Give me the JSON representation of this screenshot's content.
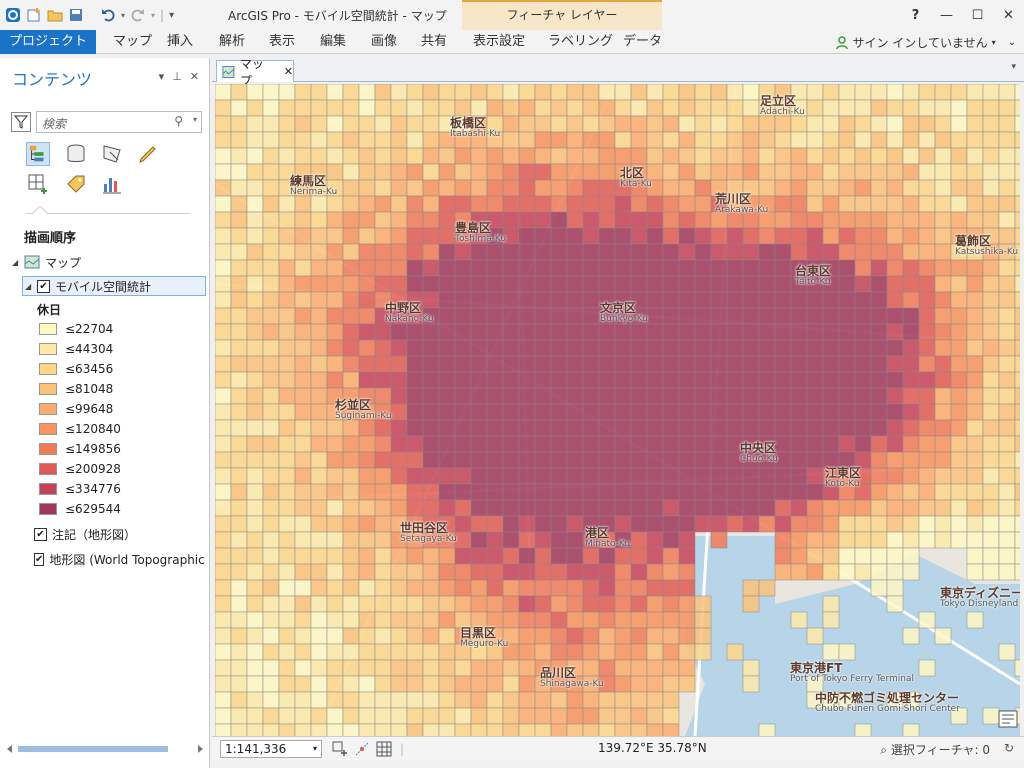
{
  "window": {
    "title": "ArcGIS Pro - モバイル空間統計 - マップ",
    "context_tab_header": "フィーチャ レイヤー",
    "help": "?"
  },
  "ribbon": {
    "tabs": [
      "プロジェクト",
      "マップ",
      "挿入",
      "解析",
      "表示",
      "編集",
      "画像",
      "共有",
      "表示設定",
      "ラベリング",
      "データ"
    ],
    "signin": "サイン インしていません"
  },
  "contents": {
    "title": "コンテンツ",
    "search_placeholder": "検索",
    "drawing_order": "描画順序",
    "map_node": "マップ",
    "layer": "モバイル空間統計",
    "legend_title": "休日",
    "legend": [
      {
        "label": "≤22704",
        "color": "#fff7c4"
      },
      {
        "label": "≤44304",
        "color": "#fde9a8"
      },
      {
        "label": "≤63456",
        "color": "#fdd68a"
      },
      {
        "label": "≤81048",
        "color": "#fcc27a"
      },
      {
        "label": "≤99648",
        "color": "#fbab6c"
      },
      {
        "label": "≤120840",
        "color": "#f8935f"
      },
      {
        "label": "≤149856",
        "color": "#f07a58"
      },
      {
        "label": "≤200928",
        "color": "#e05a55"
      },
      {
        "label": "≤334776",
        "color": "#c64258"
      },
      {
        "label": "≤629544",
        "color": "#a0365a"
      }
    ],
    "annotation_layer": "注記（地形図）",
    "basemap_layer": "地形図 (World Topographic M"
  },
  "map_tab": {
    "label": "マップ"
  },
  "map_labels": [
    {
      "text": "足立区",
      "sub": "Adachi-Ku"
    },
    {
      "text": "板橋区",
      "sub": "Itabashi-Ku"
    },
    {
      "text": "北区",
      "sub": "Kita-Ku"
    },
    {
      "text": "練馬区",
      "sub": "Nerima-Ku"
    },
    {
      "text": "荒川区",
      "sub": "Arakawa-Ku"
    },
    {
      "text": "豊島区",
      "sub": "Toshima-Ku"
    },
    {
      "text": "葛飾区",
      "sub": "Katsushika-Ku"
    },
    {
      "text": "台東区",
      "sub": "Taito-Ku"
    },
    {
      "text": "中野区",
      "sub": "Nakano-Ku"
    },
    {
      "text": "文京区",
      "sub": "Bunkyo-Ku"
    },
    {
      "text": "杉並区",
      "sub": "Suginami-Ku"
    },
    {
      "text": "中央区",
      "sub": "Chuo-Ku"
    },
    {
      "text": "江東区",
      "sub": "Koto-Ku"
    },
    {
      "text": "世田谷区",
      "sub": "Setagaya-Ku"
    },
    {
      "text": "港区",
      "sub": "Minato-Ku"
    },
    {
      "text": "目黒区",
      "sub": "Meguro-Ku"
    },
    {
      "text": "品川区",
      "sub": "Shinagawa-Ku"
    },
    {
      "text": "東京ディズニー",
      "sub": "Tokyo Disneyland"
    },
    {
      "text": "東京港FT",
      "sub": "Port of Tokyo Ferry Terminal"
    },
    {
      "text": "中防不燃ゴミ処理センター",
      "sub": "Chubo Funen Gomi Shori Center"
    }
  ],
  "status": {
    "scale": "1:141,336",
    "coords": "139.72°E 35.78°N",
    "selected": "選択フィーチャ: 0"
  }
}
